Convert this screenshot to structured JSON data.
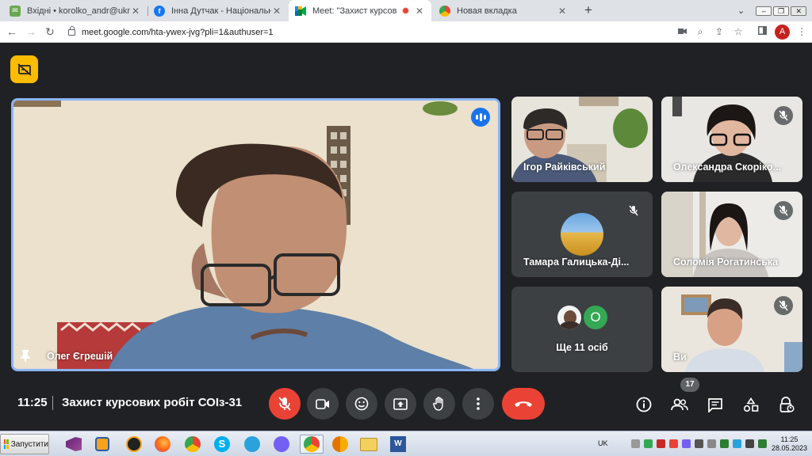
{
  "browser": {
    "tabs": [
      {
        "title": "Вхідні • korolko_andr@ukr.net",
        "favicon": "mail-icon",
        "close": "✕"
      },
      {
        "title": "Інна Дутчак - Національна спілка",
        "favicon": "facebook-icon",
        "close": "✕"
      },
      {
        "title": "Meet: \"Захист курсових робіт",
        "favicon": "meet-icon",
        "close": "✕",
        "active": true
      },
      {
        "title": "Новая вкладка",
        "favicon": "chrome-icon",
        "close": "✕"
      }
    ],
    "new_tab": "+",
    "url": "meet.google.com/hta-ywex-jvg?pli=1&authuser=1",
    "profile_initial": "A"
  },
  "meet": {
    "main_speaker": {
      "name": "Олег Єгрешій"
    },
    "participants": [
      {
        "name": "Ігор Райківський",
        "muted": false
      },
      {
        "name": "Олександра Скоріко...",
        "muted": true
      },
      {
        "name": "Тамара Галицька-Ді...",
        "muted": true
      },
      {
        "name": "Соломія Рогатинська",
        "muted": true
      },
      {
        "name": "Ви",
        "muted": true
      }
    ],
    "others": {
      "label": "Ще 11 осіб",
      "avatar_letter": "О"
    },
    "time": "11:25",
    "meeting_title": "Захист курсових робіт СОІз-31",
    "people_count": "17"
  },
  "taskbar": {
    "start_label": "Запустити",
    "language": "UK",
    "clock_time": "11:25",
    "clock_date": "28.05.2023"
  },
  "colors": {
    "accent_blue": "#8ab4f8",
    "meet_red": "#ea4335",
    "captions_yellow": "#fbbc04",
    "meet_bg": "#202124"
  }
}
